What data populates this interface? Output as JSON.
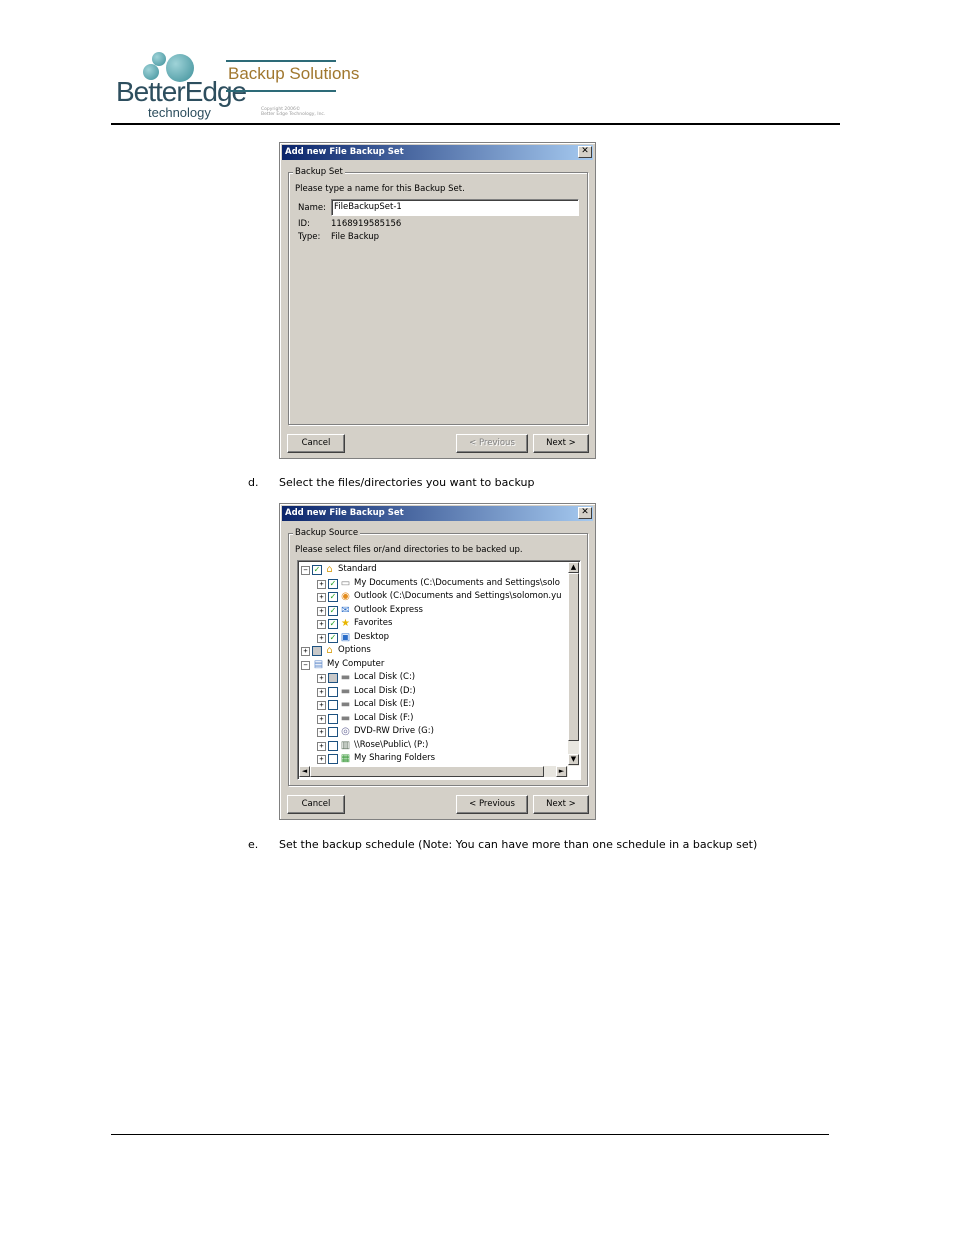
{
  "header": {
    "logo_word": "BetterEdge",
    "logo_sub": "technology",
    "brand": "Backup Solutions",
    "copyright_line1": "Copyright 2006©",
    "copyright_line2": "Better Edge Technology, Inc."
  },
  "dialog1": {
    "title": "Add new File Backup Set",
    "close": "✕",
    "group_label": "Backup Set",
    "prompt": "Please type a name for this Backup Set.",
    "name_label": "Name:",
    "name_value": "FileBackupSet-1",
    "id_label": "ID:",
    "id_value": "1168919585156",
    "type_label": "Type:",
    "type_value": "File Backup",
    "cancel": "Cancel",
    "previous": "< Previous",
    "next": "Next >"
  },
  "step_d": {
    "marker": "d.",
    "text": "Select the files/directories you want to backup"
  },
  "dialog2": {
    "title": "Add new File Backup Set",
    "close": "✕",
    "group_label": "Backup Source",
    "prompt": "Please select files or/and directories to be backed up.",
    "cancel": "Cancel",
    "previous": "< Previous",
    "next": "Next >",
    "scroll_up": "▲",
    "scroll_down": "▼",
    "scroll_left": "◄",
    "scroll_right": "►",
    "tree": [
      {
        "label": "Standard",
        "expander": "−",
        "check": "✓",
        "icon": "⌂",
        "icon_name": "folder-icon"
      },
      {
        "label": "My Documents (C:\\Documents and Settings\\solo",
        "expander": "+",
        "check": "✓",
        "icon": "▭",
        "icon_name": "documents-icon"
      },
      {
        "label": "Outlook (C:\\Documents and Settings\\solomon.yu",
        "expander": "+",
        "check": "✓",
        "icon": "◉",
        "icon_name": "outlook-icon"
      },
      {
        "label": "Outlook Express",
        "expander": "+",
        "check": "✓",
        "icon": "✉",
        "icon_name": "outlook-express-icon"
      },
      {
        "label": "Favorites",
        "expander": "+",
        "check": "✓",
        "icon": "★",
        "icon_name": "favorites-icon"
      },
      {
        "label": "Desktop",
        "expander": "+",
        "check": "✓",
        "icon": "▣",
        "icon_name": "desktop-icon"
      },
      {
        "label": "Options",
        "expander": "+",
        "check": "",
        "icon": "⌂",
        "icon_name": "folder-icon"
      },
      {
        "label": "My Computer",
        "expander": "−",
        "check": "",
        "icon": "▤",
        "icon_name": "computer-icon"
      },
      {
        "label": "Local Disk (C:)",
        "expander": "+",
        "check": "",
        "icon": "▬",
        "icon_name": "disk-icon"
      },
      {
        "label": "Local Disk (D:)",
        "expander": "+",
        "check": "",
        "icon": "▬",
        "icon_name": "disk-icon"
      },
      {
        "label": "Local Disk (E:)",
        "expander": "+",
        "check": "",
        "icon": "▬",
        "icon_name": "disk-icon"
      },
      {
        "label": "Local Disk (F:)",
        "expander": "+",
        "check": "",
        "icon": "▬",
        "icon_name": "disk-icon"
      },
      {
        "label": "DVD-RW Drive (G:)",
        "expander": "+",
        "check": "",
        "icon": "◎",
        "icon_name": "dvd-drive-icon"
      },
      {
        "label": "\\\\Rose\\Public\\ (P:)",
        "expander": "+",
        "check": "",
        "icon": "▥",
        "icon_name": "network-drive-icon"
      },
      {
        "label": "My Sharing Folders",
        "expander": "+",
        "check": "",
        "icon": "▦",
        "icon_name": "sharing-folder-icon"
      }
    ]
  },
  "step_e": {
    "marker": "e.",
    "text": "Set the backup schedule (Note: You can have more than one schedule in a backup set)"
  }
}
